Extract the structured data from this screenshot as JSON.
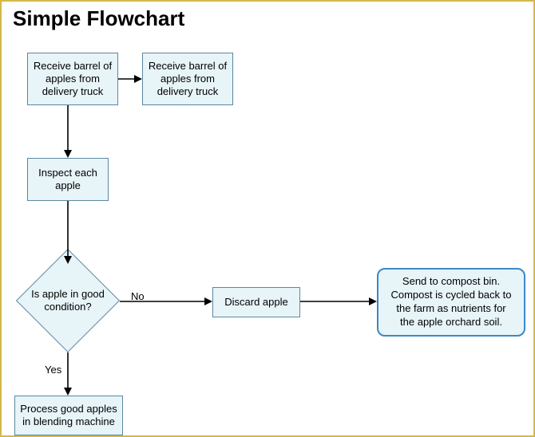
{
  "title": "Simple Flowchart",
  "nodes": {
    "receive1": "Receive barrel of apples from delivery truck",
    "receive2": "Receive barrel of apples from delivery truck",
    "inspect": "Inspect each apple",
    "decision": "Is apple in good condition?",
    "discard": "Discard apple",
    "process": "Process good apples in blending machine",
    "compost_note": "Send to compost bin. Compost is cycled back to the farm as nutrients for the apple orchard soil."
  },
  "edges": {
    "no": "No",
    "yes": "Yes"
  },
  "colors": {
    "frame_border": "#d6b84a",
    "node_fill": "#e7f4f8",
    "node_border": "#5b88a3",
    "callout_border": "#3a89c6"
  }
}
